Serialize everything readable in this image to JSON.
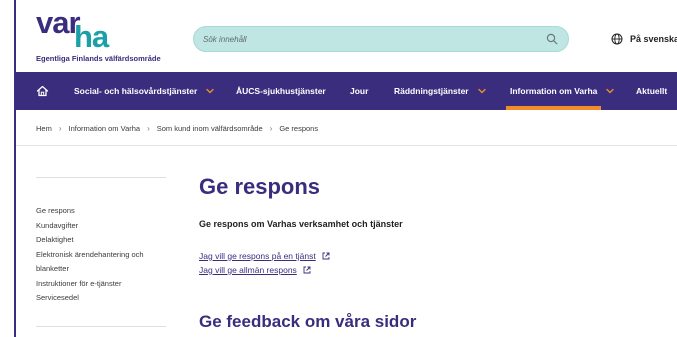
{
  "brand": {
    "logo_part1": "var",
    "logo_part2": "ha",
    "tagline": "Egentliga Finlands välfärdsområde",
    "primary_color": "#3a2d7e",
    "accent_color": "#1aa0a6",
    "highlight_color": "#f28c2a"
  },
  "search": {
    "placeholder": "Sök innehåll",
    "icon": "search-icon"
  },
  "language": {
    "label": "På svenska",
    "icon": "globe-icon"
  },
  "nav": {
    "home_icon": "home-icon",
    "items": [
      {
        "label": "Social- och hälsovårdstjänster",
        "has_dropdown": true
      },
      {
        "label": "ÅUCS-sjukhustjänster",
        "has_dropdown": false
      },
      {
        "label": "Jour",
        "has_dropdown": false
      },
      {
        "label": "Räddningstjänster",
        "has_dropdown": true
      },
      {
        "label": "Information om Varha",
        "has_dropdown": true,
        "active": true
      },
      {
        "label": "Aktuellt",
        "has_dropdown": false
      }
    ]
  },
  "breadcrumb": [
    "Hem",
    "Information om Varha",
    "Som kund inom välfärdsområde",
    "Ge respons"
  ],
  "sidebar": {
    "items": [
      "Ge respons",
      "Kundavgifter",
      "Delaktighet",
      "Elektronisk ärendehantering och blanketter",
      "Instruktioner för e-tjänster",
      "Servicesedel"
    ]
  },
  "main": {
    "title": "Ge respons",
    "intro": "Ge respons om Varhas verksamhet och tjänster",
    "links": [
      {
        "label": "Jag vill ge respons på en tjänst",
        "external": true
      },
      {
        "label": "Jag vill ge allmän respons",
        "external": true
      }
    ],
    "section_title": "Ge feedback om våra sidor"
  }
}
